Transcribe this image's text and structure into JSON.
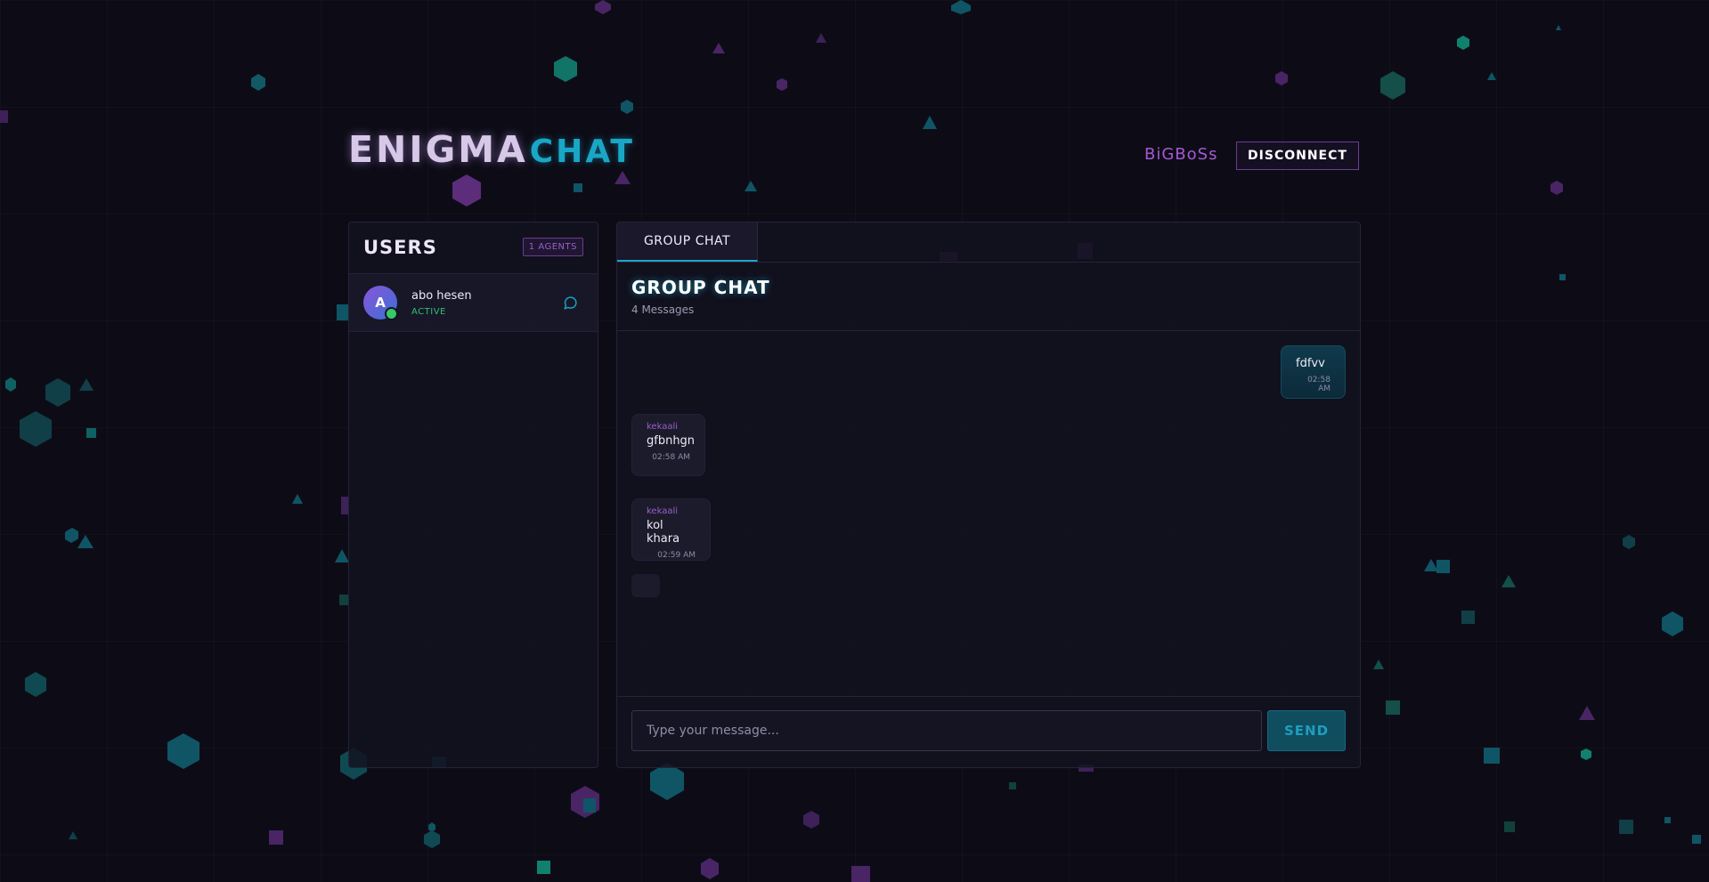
{
  "app": {
    "logo_primary": "ENIGMA",
    "logo_secondary": "CHAT"
  },
  "header": {
    "username": "BiGBoSs",
    "disconnect_label": "DISCONNECT"
  },
  "users_panel": {
    "title": "USERS",
    "agents_badge": "1 AGENTS",
    "users": [
      {
        "initial": "A",
        "name": "abo hesen",
        "status": "ACTIVE",
        "icon": "chat-bubble-icon"
      }
    ]
  },
  "chat": {
    "tabs": [
      {
        "label": "GROUP CHAT",
        "active": true
      }
    ],
    "title": "GROUP CHAT",
    "message_count": "4 Messages",
    "messages": [
      {
        "direction": "outgoing",
        "sender": "",
        "text": "fdfvv",
        "time": "02:58 AM"
      },
      {
        "direction": "incoming",
        "sender": "kekaali",
        "text": "gfbnhgn",
        "time": "02:58 AM"
      },
      {
        "direction": "incoming",
        "sender": "kekaali",
        "text": "kol khara",
        "time": "02:59 AM"
      }
    ],
    "input_placeholder": "Type your message...",
    "send_label": "SEND"
  },
  "colors": {
    "background": "#0d0c16",
    "accent_cyan": "#1aa7c7",
    "accent_purple": "#a558d6",
    "status_green": "#30c070"
  }
}
